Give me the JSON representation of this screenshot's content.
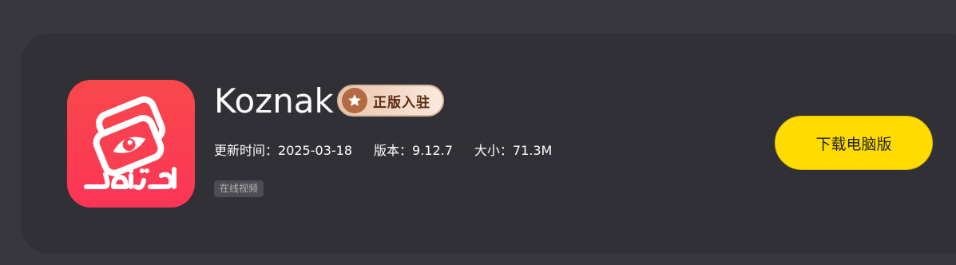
{
  "app": {
    "name": "Koznak",
    "icon": "koznak-logo-icon",
    "icon_text": "كۆزنەك",
    "badge": {
      "label": "正版入驻",
      "icon": "star-icon"
    },
    "meta": {
      "update_label": "更新时间：",
      "update_value": "2025-03-18",
      "version_label": "版本：",
      "version_value": "9.12.7",
      "size_label": "大小：",
      "size_value": "71.3M"
    },
    "tags": [
      "在线视频"
    ]
  },
  "actions": {
    "download_label": "下载电脑版"
  },
  "colors": {
    "background": "#38373d",
    "card": "#313036",
    "icon_gradient_top": "#f8484b",
    "icon_gradient_bottom": "#fd3557",
    "download_button": "#ffdc00",
    "badge_accent": "#b46a42"
  }
}
